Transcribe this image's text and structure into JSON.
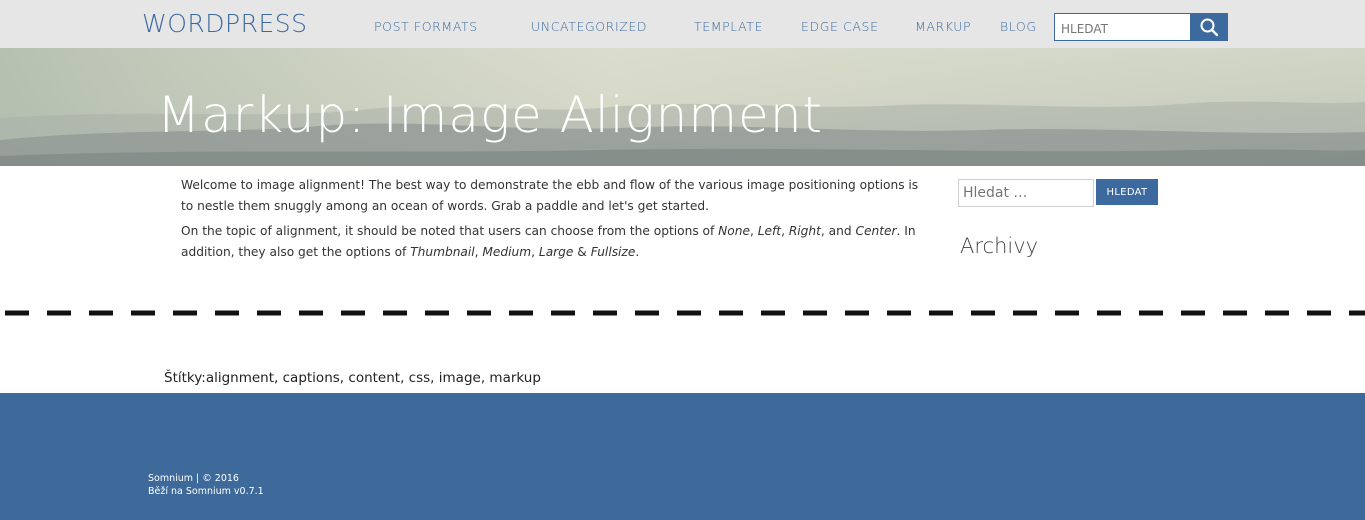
{
  "header": {
    "brand": "WORDPRESS",
    "nav": [
      {
        "label": "POST FORMATS"
      },
      {
        "label": "UNCATEGORIZED"
      },
      {
        "label": "TEMPLATE"
      },
      {
        "label": "EDGE CASE"
      },
      {
        "label": "MARKUP"
      },
      {
        "label": "BLOG"
      }
    ],
    "search_placeholder": "HLEDAT",
    "search_icon": "search-icon"
  },
  "hero": {
    "title": "Markup: Image Alignment"
  },
  "article": {
    "paragraph1": "Welcome to image alignment! The best way to demonstrate the ebb and flow of the various image positioning options is to nestle them snuggly among an ocean of words. Grab a paddle and let's get started.",
    "p2_intro": "On the topic of alignment, it should be noted that users can choose from the options of ",
    "p2_none": "None",
    "p2_left": "Left",
    "p2_right": "Right",
    "p2_and": "and",
    "p2_center": "Center",
    "p2_mid": ". In addition, they also get the options of ",
    "p2_thumbnail": "Thumbnail",
    "p2_medium": "Medium",
    "p2_large": "Large",
    "p2_amp": "&",
    "p2_fullsize": "Fullsize",
    "p2_end": "."
  },
  "sidebar": {
    "search_placeholder": "Hledat …",
    "search_button": "HLEDAT",
    "archive_heading": "Archivy"
  },
  "tags": {
    "label": "Štítky:",
    "items": [
      "alignment",
      "captions",
      "content",
      "css",
      "image",
      "markup"
    ]
  },
  "footer": {
    "line1": "Somnium | © 2016",
    "line2": "Běží na Somnium v0.7.1"
  },
  "colors": {
    "accent": "#3d6a9e",
    "topbar": "#e6e6e6",
    "footer": "#3d6a9a"
  }
}
